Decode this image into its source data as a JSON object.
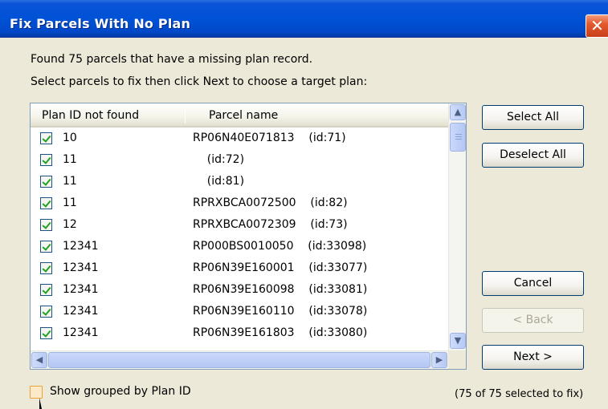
{
  "window": {
    "title": "Fix Parcels With No Plan",
    "close_glyph": "✕"
  },
  "message": {
    "line1": "Found 75 parcels that have a missing plan record.",
    "line2": "Select parcels to fix then click Next to choose a target plan:"
  },
  "list": {
    "columns": [
      "Plan ID not found",
      "Parcel name"
    ],
    "rows": [
      {
        "checked": true,
        "plan": "10",
        "parcel": "RP06N40E071813    (id:71)"
      },
      {
        "checked": true,
        "plan": "11",
        "parcel": "    (id:72)"
      },
      {
        "checked": true,
        "plan": "11",
        "parcel": "    (id:81)"
      },
      {
        "checked": true,
        "plan": "11",
        "parcel": "RPRXBCA0072500    (id:82)"
      },
      {
        "checked": true,
        "plan": "12",
        "parcel": "RPRXBCA0072309    (id:73)"
      },
      {
        "checked": true,
        "plan": "12341",
        "parcel": "RP000BS0010050    (id:33098)"
      },
      {
        "checked": true,
        "plan": "12341",
        "parcel": "RP06N39E160001    (id:33077)"
      },
      {
        "checked": true,
        "plan": "12341",
        "parcel": "RP06N39E160098    (id:33081)"
      },
      {
        "checked": true,
        "plan": "12341",
        "parcel": "RP06N39E160110    (id:33078)"
      },
      {
        "checked": true,
        "plan": "12341",
        "parcel": "RP06N39E161803    (id:33080)"
      }
    ]
  },
  "buttons": {
    "select_all": "Select All",
    "deselect_all": "Deselect All",
    "cancel": "Cancel",
    "back": "< Back",
    "next": "Next >"
  },
  "options": {
    "grouped_label": "Show grouped by Plan ID",
    "grouped_checked": false
  },
  "status": "(75 of 75 selected to fix)",
  "colors": {
    "title_bar": "#0052d6",
    "close_button": "#e3592f",
    "check_mark": "#21a121"
  }
}
